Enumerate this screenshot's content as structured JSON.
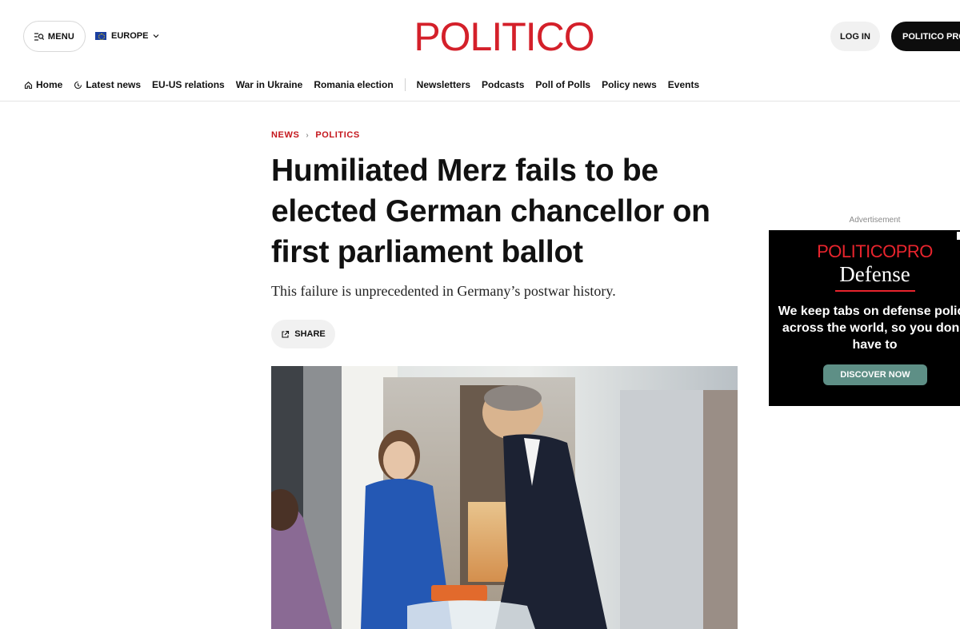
{
  "header": {
    "menu_label": "MENU",
    "edition_label": "EUROPE",
    "logo_text": "POLITICO",
    "login_label": "LOG IN",
    "pro_label": "POLITICO PRO"
  },
  "nav": {
    "items": [
      "Home",
      "Latest news",
      "EU-US relations",
      "War in Ukraine",
      "Romania election"
    ],
    "secondary_items": [
      "Newsletters",
      "Podcasts",
      "Poll of Polls",
      "Policy news",
      "Events"
    ]
  },
  "article": {
    "breadcrumb": [
      "NEWS",
      "POLITICS"
    ],
    "headline": "Humiliated Merz fails to be elected German chancellor on first parliament ballot",
    "dek": "This failure is unprecedented in Germany’s postwar history.",
    "share_label": "SHARE"
  },
  "ad": {
    "label": "Advertisement",
    "brand_politico": "POLITICO",
    "brand_pro": "PRO",
    "product": "Defense",
    "copy": "We keep tabs on defense policy across the world, so you don’t have to",
    "cta": "DISCOVER NOW"
  },
  "colors": {
    "brand_red": "#d4202a",
    "cta_green": "#5e8f86"
  }
}
